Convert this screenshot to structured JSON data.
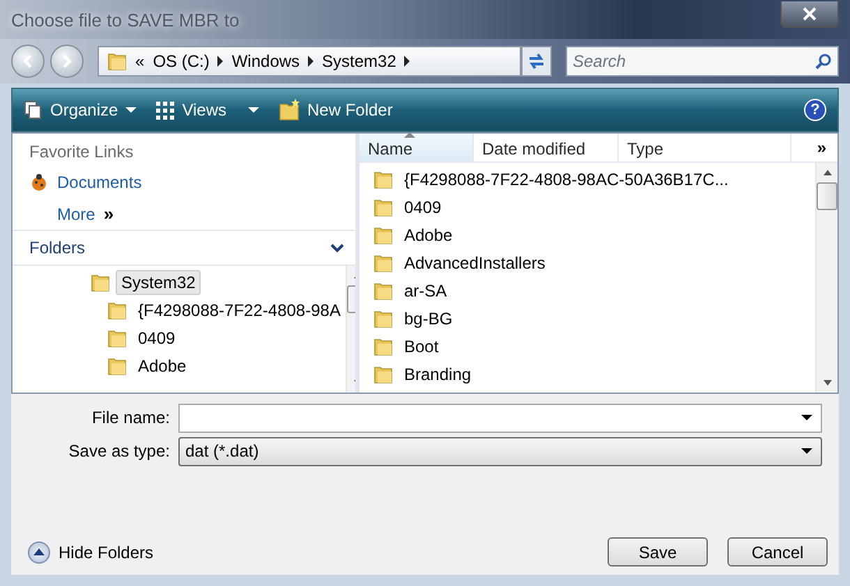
{
  "window": {
    "title": "Choose file to SAVE MBR to"
  },
  "address_bar": {
    "overflow": "«",
    "segments": [
      "OS (C:)",
      "Windows",
      "System32"
    ]
  },
  "search": {
    "placeholder": "Search"
  },
  "help_glyph": "?",
  "toolbar": {
    "items": [
      {
        "label": "Organize",
        "kind": "organize"
      },
      {
        "label": "Views",
        "kind": "views"
      },
      {
        "label": "New Folder",
        "kind": "newfolder"
      }
    ]
  },
  "favorite_links": {
    "title": "Favorite Links",
    "items": [
      "Documents"
    ],
    "more": "More",
    "more_glyph": "»"
  },
  "folders": {
    "title": "Folders",
    "expanded": true,
    "tree": [
      {
        "label": "System32",
        "selected": true,
        "children": [
          {
            "label": "{F4298088-7F22-4808-98A",
            "selected": false
          },
          {
            "label": "0409",
            "selected": false
          },
          {
            "label": "Adobe",
            "selected": false
          }
        ]
      }
    ]
  },
  "file_list": {
    "columns": [
      {
        "label": "Name",
        "sorted": true
      },
      {
        "label": "Date modified",
        "sorted": false
      },
      {
        "label": "Type",
        "sorted": false
      }
    ],
    "more_columns": "»",
    "rows": [
      "{F4298088-7F22-4808-98AC-50A36B17C...",
      "0409",
      "Adobe",
      "AdvancedInstallers",
      "ar-SA",
      "bg-BG",
      "Boot",
      "Branding"
    ]
  },
  "file_name": {
    "label": "File name:"
  },
  "save_as_type": {
    "label": "Save as type:",
    "value": "dat (*.dat)"
  },
  "hide_folders": "Hide Folders",
  "buttons": [
    "Save",
    "Cancel"
  ]
}
